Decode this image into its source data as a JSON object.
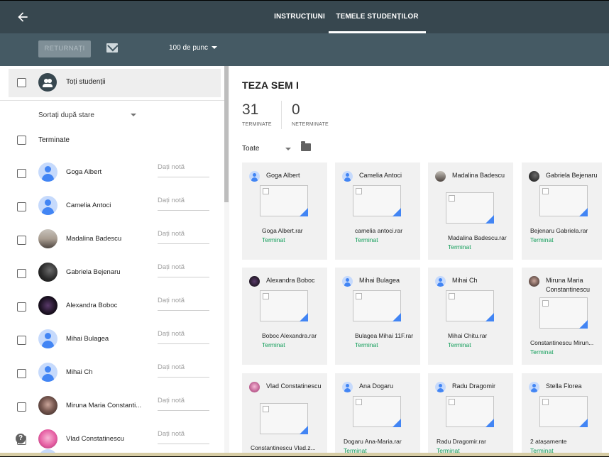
{
  "header": {
    "tabs": [
      {
        "label": "INSTRUCȚIUNI"
      },
      {
        "label": "TEMELE STUDENȚILOR"
      }
    ]
  },
  "toolbar": {
    "return_label": "RETURNAȚI",
    "points_label": "100 de punc"
  },
  "sidebar": {
    "all_students_label": "Toți studenții",
    "sort_label": "Sortați după stare",
    "section_label": "Terminate",
    "grade_placeholder": "Dați notă",
    "students": [
      {
        "name": "Goga Albert",
        "grade": "Dați notă",
        "avatar": "default"
      },
      {
        "name": "Camelia Antoci",
        "grade": "Dați notă",
        "avatar": "default"
      },
      {
        "name": "Madalina Badescu",
        "grade": "Dați notă",
        "avatar": "photo"
      },
      {
        "name": "Gabriela Bejenaru",
        "grade": "Dați notă",
        "avatar": "photo"
      },
      {
        "name": "Alexandra Boboc",
        "grade": "Dați notă",
        "avatar": "photo"
      },
      {
        "name": "Mihai Bulagea",
        "grade": "Dați notă",
        "avatar": "default"
      },
      {
        "name": "Mihai Ch",
        "grade": "Dați notă",
        "avatar": "default"
      },
      {
        "name": "Miruna Maria Constanti...",
        "grade": "Dați notă",
        "avatar": "photo"
      },
      {
        "name": "Vlad Constatinescu",
        "grade": "Dați notă",
        "avatar": "photo"
      }
    ]
  },
  "main": {
    "title": "TEZA SEM I",
    "stats": {
      "done_count": "31",
      "done_label": "TERMINATE",
      "notdone_count": "0",
      "notdone_label": "NETERMINATE"
    },
    "filter_label": "Toate",
    "cards": [
      {
        "name": "Goga Albert",
        "file": "Goga Albert.rar",
        "status": "Terminat"
      },
      {
        "name": "Camelia Antoci",
        "file": "camelia antoci.rar",
        "status": "Terminat"
      },
      {
        "name": "Madalina Badescu",
        "file": "Madalina Badescu.rar",
        "status": "Terminat"
      },
      {
        "name": "Gabriela Bejenaru",
        "file": "Bejenaru Gabriela.rar",
        "status": "Terminat"
      },
      {
        "name": "Alexandra Boboc",
        "file": "Boboc Alexandra.rar",
        "status": "Terminat"
      },
      {
        "name": "Mihai Bulagea",
        "file": "Bulagea Mihai 11F.rar",
        "status": "Terminat"
      },
      {
        "name": "Mihai Ch",
        "file": "Mihai Chitu.rar",
        "status": "Terminat"
      },
      {
        "name": "Miruna Maria Constantinescu",
        "file": "Constantinescu Mirun...",
        "status": "Terminat"
      },
      {
        "name": "Vlad Constatinescu",
        "file": "Constantinescu Vlad.z...",
        "status": ""
      },
      {
        "name": "Ana Dogaru",
        "file": "Dogaru Ana-Maria.rar",
        "status": "Terminat"
      },
      {
        "name": "Radu Dragomir",
        "file": "Radu Dragomir.rar",
        "status": "Terminat"
      },
      {
        "name": "Stella Florea",
        "file": "2 atașamente",
        "status": "Terminat"
      }
    ]
  },
  "help_label": "?"
}
